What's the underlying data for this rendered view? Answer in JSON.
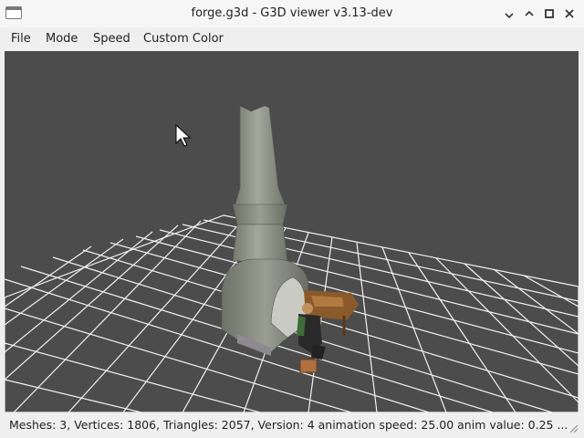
{
  "window": {
    "title": "forge.g3d - G3D viewer v3.13-dev",
    "controls": {
      "minimize": "‒",
      "maximize": "□",
      "close": "✕"
    }
  },
  "menu": {
    "items": [
      "File",
      "Mode",
      "Speed",
      "Custom Color"
    ]
  },
  "status": {
    "text": "Meshes: 3, Vertices: 1806, Triangles: 2057, Version: 4 animation speed: 25.00 anim value: 0.25 ..."
  },
  "viewport": {
    "background": "#4c4c4c",
    "grid_color": "#ffffff",
    "model": "forge",
    "cursor_icon": "arrow-cursor-icon"
  }
}
